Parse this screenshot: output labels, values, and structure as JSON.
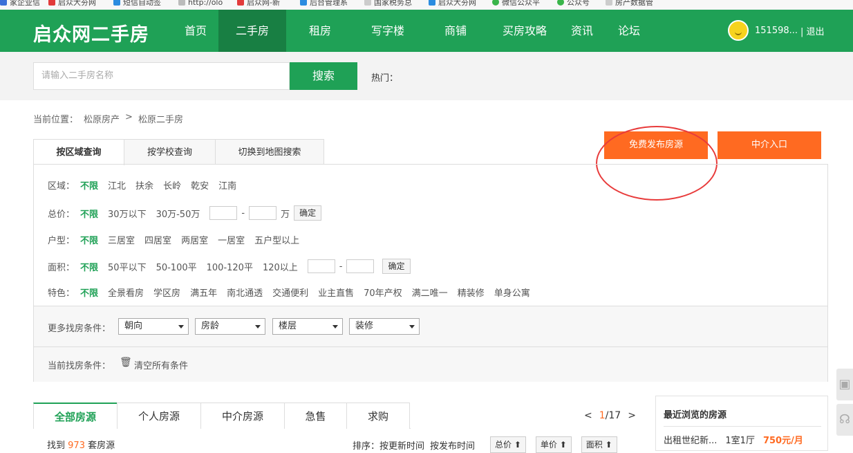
{
  "bookmarks": [
    {
      "label": "家企业信",
      "color": "#3a6fd8"
    },
    {
      "label": "启众大夯网",
      "color": "#e23b3b"
    },
    {
      "label": "短信自动签",
      "color": "#2b8ce0"
    },
    {
      "label": "http://olo",
      "color": "#bbbbbb"
    },
    {
      "label": "启众网-新",
      "color": "#e23b3b"
    },
    {
      "label": "后台管理系",
      "color": "#2b8ce0"
    },
    {
      "label": "国家税务总",
      "color": "#cccccc"
    },
    {
      "label": "启众大夯网",
      "color": "#2b8ce0"
    },
    {
      "label": "微信公众平",
      "color": "#39b54a"
    },
    {
      "label": "公众号",
      "color": "#39b54a"
    },
    {
      "label": "房产数据管",
      "color": "#cccccc"
    }
  ],
  "header": {
    "logo": "启众网二手房",
    "nav": [
      "首页",
      "二手房",
      "租房",
      "写字楼",
      "商铺",
      "买房攻略",
      "资讯",
      "论坛"
    ],
    "active_nav": "二手房",
    "user_name": "151598...",
    "logout": "| 退出"
  },
  "search": {
    "placeholder": "请输入二手房名称",
    "button": "搜索",
    "hot_label": "热门："
  },
  "breadcrumb": {
    "label": "当前位置：",
    "items": [
      "松原房产",
      ">",
      "松原二手房"
    ]
  },
  "actions": {
    "publish": "免费发布房源",
    "agent": "中介入口"
  },
  "query_tabs": [
    "按区域查询",
    "按学校查询",
    "切换到地图搜索"
  ],
  "filters": {
    "region": {
      "label": "区域：",
      "options": [
        "不限",
        "江北",
        "扶余",
        "长岭",
        "乾安",
        "江南"
      ]
    },
    "price": {
      "label": "总价：",
      "options": [
        "不限",
        "30万以下",
        "30万-50万"
      ],
      "unit": "万",
      "dash": "-",
      "ok": "确定"
    },
    "layout": {
      "label": "户型：",
      "options": [
        "不限",
        "三居室",
        "四居室",
        "两居室",
        "一居室",
        "五户型以上"
      ]
    },
    "area": {
      "label": "面积：",
      "options": [
        "不限",
        "50平以下",
        "50-100平",
        "100-120平",
        "120以上"
      ],
      "dash": "-",
      "ok": "确定"
    },
    "feature": {
      "label": "特色：",
      "options": [
        "不限",
        "全景看房",
        "学区房",
        "满五年",
        "南北通透",
        "交通便利",
        "业主直售",
        "70年产权",
        "满二唯一",
        "精装修",
        "单身公寓"
      ]
    }
  },
  "more": {
    "label": "更多找房条件：",
    "selects": [
      "朝向",
      "房龄",
      "楼层",
      "装修"
    ]
  },
  "current": {
    "label": "当前找房条件：",
    "clear": "清空所有条件"
  },
  "result_tabs": [
    "全部房源",
    "个人房源",
    "中介房源",
    "急售",
    "求购"
  ],
  "pager": {
    "prev": "<",
    "current": "1",
    "total": "/17",
    "next": ">"
  },
  "results": {
    "found_prefix": "找到",
    "count": "973",
    "found_suffix": "套房源",
    "sort_label": "排序：按更新时间",
    "sort_publish": "按发布时间",
    "sort_buttons": [
      "总价 ⬆",
      "单价 ⬆",
      "面积 ⬆"
    ]
  },
  "recent": {
    "title": "最近浏览的房源",
    "item_name": "出租世纪新...",
    "item_layout": "1室1厅",
    "item_price": "750元/月"
  },
  "colors": {
    "brand": "#1fa156",
    "accent": "#ff6a21",
    "annotation": "#e83b3b"
  }
}
